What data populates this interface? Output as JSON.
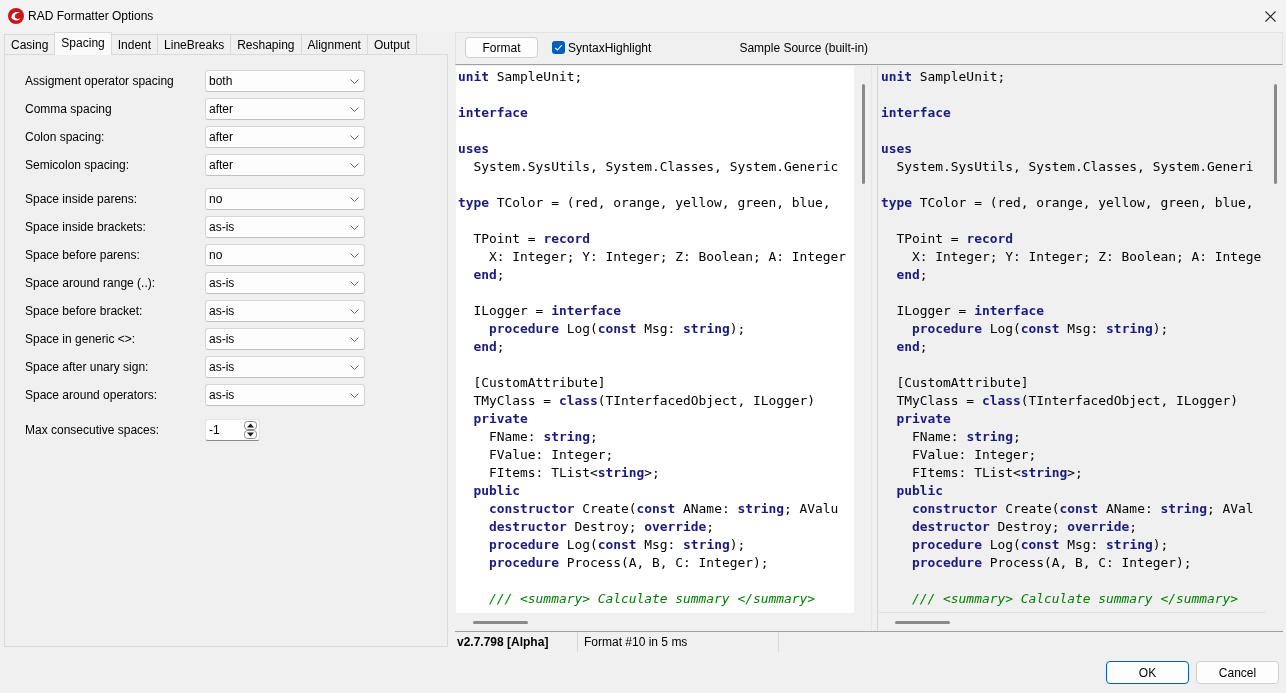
{
  "window": {
    "title": "RAD Formatter Options"
  },
  "tabs": [
    {
      "label": "Casing",
      "selected": false
    },
    {
      "label": "Spacing",
      "selected": true
    },
    {
      "label": "Indent",
      "selected": false
    },
    {
      "label": "LineBreaks",
      "selected": false
    },
    {
      "label": "Reshaping",
      "selected": false
    },
    {
      "label": "Alignment",
      "selected": false
    },
    {
      "label": "Output",
      "selected": false
    }
  ],
  "setting_groups": [
    {
      "settings": [
        {
          "kind": "dropdown",
          "label": "Assigment operator spacing",
          "value": "both"
        },
        {
          "kind": "dropdown",
          "label": "Comma spacing",
          "value": "after"
        },
        {
          "kind": "dropdown",
          "label": "Colon spacing:",
          "value": "after"
        },
        {
          "kind": "dropdown",
          "label": "Semicolon spacing:",
          "value": "after"
        }
      ]
    },
    {
      "settings": [
        {
          "kind": "dropdown",
          "label": "Space inside parens:",
          "value": "no"
        },
        {
          "kind": "dropdown",
          "label": "Space inside brackets:",
          "value": "as-is"
        },
        {
          "kind": "dropdown",
          "label": "Space before parens:",
          "value": "no"
        },
        {
          "kind": "dropdown",
          "label": "Space around range (..):",
          "value": "as-is"
        },
        {
          "kind": "dropdown",
          "label": "Space before bracket:",
          "value": "as-is"
        },
        {
          "kind": "dropdown",
          "label": "Space in generic <>:",
          "value": "as-is"
        },
        {
          "kind": "dropdown",
          "label": "Space after unary sign:",
          "value": "as-is"
        },
        {
          "kind": "dropdown",
          "label": "Space around operators:",
          "value": "as-is"
        }
      ]
    },
    {
      "settings": [
        {
          "kind": "spinner",
          "label": "Max consecutive spaces:",
          "value": "-1"
        }
      ]
    }
  ],
  "toolbar": {
    "format_button": "Format",
    "syntax_highlight": {
      "label": "SyntaxHighlight",
      "checked": true
    },
    "source_label": "Sample Source (built-in)"
  },
  "editors": [
    {
      "read_only": false,
      "blocks": [
        {
          "lines": [
            {
              "tokens": [
                {
                  "kind": "keyword",
                  "text": "unit"
                },
                {
                  "kind": "plain",
                  "text": " SampleUnit;"
                }
              ]
            }
          ]
        },
        {
          "lines": [
            {
              "tokens": [
                {
                  "kind": "keyword",
                  "text": "interface"
                }
              ]
            }
          ]
        },
        {
          "lines": [
            {
              "tokens": [
                {
                  "kind": "keyword",
                  "text": "uses"
                }
              ]
            },
            {
              "tokens": [
                {
                  "kind": "plain",
                  "text": "  System.SysUtils, System.Classes, System.Generic"
                }
              ]
            }
          ]
        },
        {
          "lines": [
            {
              "tokens": [
                {
                  "kind": "keyword",
                  "text": "type"
                },
                {
                  "kind": "plain",
                  "text": " TColor = (red, orange, yellow, green, blue,"
                }
              ]
            }
          ]
        },
        {
          "lines": [
            {
              "tokens": [
                {
                  "kind": "plain",
                  "text": "  TPoint = "
                },
                {
                  "kind": "keyword",
                  "text": "record"
                }
              ]
            },
            {
              "tokens": [
                {
                  "kind": "plain",
                  "text": "    X: Integer; Y: Integer; Z: Boolean; A: Integer"
                }
              ]
            },
            {
              "tokens": [
                {
                  "kind": "keyword",
                  "text": "  end"
                },
                {
                  "kind": "plain",
                  "text": ";"
                }
              ]
            }
          ]
        },
        {
          "lines": [
            {
              "tokens": [
                {
                  "kind": "plain",
                  "text": "  ILogger = "
                },
                {
                  "kind": "keyword",
                  "text": "interface"
                }
              ]
            },
            {
              "tokens": [
                {
                  "kind": "keyword",
                  "text": "    procedure"
                },
                {
                  "kind": "plain",
                  "text": " Log("
                },
                {
                  "kind": "keyword",
                  "text": "const"
                },
                {
                  "kind": "plain",
                  "text": " Msg: "
                },
                {
                  "kind": "keyword",
                  "text": "string"
                },
                {
                  "kind": "plain",
                  "text": ");"
                }
              ]
            },
            {
              "tokens": [
                {
                  "kind": "keyword",
                  "text": "  end"
                },
                {
                  "kind": "plain",
                  "text": ";"
                }
              ]
            }
          ]
        },
        {
          "lines": [
            {
              "tokens": [
                {
                  "kind": "plain",
                  "text": "  [CustomAttribute]"
                }
              ]
            },
            {
              "tokens": [
                {
                  "kind": "plain",
                  "text": "  TMyClass = "
                },
                {
                  "kind": "keyword",
                  "text": "class"
                },
                {
                  "kind": "plain",
                  "text": "(TInterfacedObject, ILogger)"
                }
              ]
            },
            {
              "tokens": [
                {
                  "kind": "keyword",
                  "text": "  private"
                }
              ]
            },
            {
              "tokens": [
                {
                  "kind": "plain",
                  "text": "    FName: "
                },
                {
                  "kind": "keyword",
                  "text": "string"
                },
                {
                  "kind": "plain",
                  "text": ";"
                }
              ]
            },
            {
              "tokens": [
                {
                  "kind": "plain",
                  "text": "    FValue: Integer;"
                }
              ]
            },
            {
              "tokens": [
                {
                  "kind": "plain",
                  "text": "    FItems: TList<"
                },
                {
                  "kind": "keyword",
                  "text": "string"
                },
                {
                  "kind": "plain",
                  "text": ">;"
                }
              ]
            },
            {
              "tokens": [
                {
                  "kind": "keyword",
                  "text": "  public"
                }
              ]
            },
            {
              "tokens": [
                {
                  "kind": "keyword",
                  "text": "    constructor"
                },
                {
                  "kind": "plain",
                  "text": " Create("
                },
                {
                  "kind": "keyword",
                  "text": "const"
                },
                {
                  "kind": "plain",
                  "text": " AName: "
                },
                {
                  "kind": "keyword",
                  "text": "string"
                },
                {
                  "kind": "plain",
                  "text": "; AValu"
                }
              ]
            },
            {
              "tokens": [
                {
                  "kind": "keyword",
                  "text": "    destructor"
                },
                {
                  "kind": "plain",
                  "text": " Destroy; "
                },
                {
                  "kind": "keyword",
                  "text": "override"
                },
                {
                  "kind": "plain",
                  "text": ";"
                }
              ]
            },
            {
              "tokens": [
                {
                  "kind": "keyword",
                  "text": "    procedure"
                },
                {
                  "kind": "plain",
                  "text": " Log("
                },
                {
                  "kind": "keyword",
                  "text": "const"
                },
                {
                  "kind": "plain",
                  "text": " Msg: "
                },
                {
                  "kind": "keyword",
                  "text": "string"
                },
                {
                  "kind": "plain",
                  "text": ");"
                }
              ]
            },
            {
              "tokens": [
                {
                  "kind": "keyword",
                  "text": "    procedure"
                },
                {
                  "kind": "plain",
                  "text": " Process(A, B, C: Integer);"
                }
              ]
            }
          ]
        },
        {
          "lines": [
            {
              "tokens": [
                {
                  "kind": "comment",
                  "text": "    /// <summary> Calculate summary </summary>"
                }
              ]
            }
          ]
        }
      ]
    },
    {
      "read_only": true,
      "blocks": [
        {
          "lines": [
            {
              "tokens": [
                {
                  "kind": "keyword",
                  "text": "unit"
                },
                {
                  "kind": "plain",
                  "text": " SampleUnit;"
                }
              ]
            }
          ]
        },
        {
          "lines": [
            {
              "tokens": [
                {
                  "kind": "keyword",
                  "text": "interface"
                }
              ]
            }
          ]
        },
        {
          "lines": [
            {
              "tokens": [
                {
                  "kind": "keyword",
                  "text": "uses"
                }
              ]
            },
            {
              "tokens": [
                {
                  "kind": "plain",
                  "text": "  System.SysUtils, System.Classes, System.Generi"
                }
              ]
            }
          ]
        },
        {
          "lines": [
            {
              "tokens": [
                {
                  "kind": "keyword",
                  "text": "type"
                },
                {
                  "kind": "plain",
                  "text": " TColor = (red, orange, yellow, green, blue,"
                }
              ]
            }
          ]
        },
        {
          "lines": [
            {
              "tokens": [
                {
                  "kind": "plain",
                  "text": "  TPoint = "
                },
                {
                  "kind": "keyword",
                  "text": "record"
                }
              ]
            },
            {
              "tokens": [
                {
                  "kind": "plain",
                  "text": "    X: Integer; Y: Integer; Z: Boolean; A: Intege"
                }
              ]
            },
            {
              "tokens": [
                {
                  "kind": "keyword",
                  "text": "  end"
                },
                {
                  "kind": "plain",
                  "text": ";"
                }
              ]
            }
          ]
        },
        {
          "lines": [
            {
              "tokens": [
                {
                  "kind": "plain",
                  "text": "  ILogger = "
                },
                {
                  "kind": "keyword",
                  "text": "interface"
                }
              ]
            },
            {
              "tokens": [
                {
                  "kind": "keyword",
                  "text": "    procedure"
                },
                {
                  "kind": "plain",
                  "text": " Log("
                },
                {
                  "kind": "keyword",
                  "text": "const"
                },
                {
                  "kind": "plain",
                  "text": " Msg: "
                },
                {
                  "kind": "keyword",
                  "text": "string"
                },
                {
                  "kind": "plain",
                  "text": ");"
                }
              ]
            },
            {
              "tokens": [
                {
                  "kind": "keyword",
                  "text": "  end"
                },
                {
                  "kind": "plain",
                  "text": ";"
                }
              ]
            }
          ]
        },
        {
          "lines": [
            {
              "tokens": [
                {
                  "kind": "plain",
                  "text": "  [CustomAttribute]"
                }
              ]
            },
            {
              "tokens": [
                {
                  "kind": "plain",
                  "text": "  TMyClass = "
                },
                {
                  "kind": "keyword",
                  "text": "class"
                },
                {
                  "kind": "plain",
                  "text": "(TInterfacedObject, ILogger)"
                }
              ]
            },
            {
              "tokens": [
                {
                  "kind": "keyword",
                  "text": "  private"
                }
              ]
            },
            {
              "tokens": [
                {
                  "kind": "plain",
                  "text": "    FName: "
                },
                {
                  "kind": "keyword",
                  "text": "string"
                },
                {
                  "kind": "plain",
                  "text": ";"
                }
              ]
            },
            {
              "tokens": [
                {
                  "kind": "plain",
                  "text": "    FValue: Integer;"
                }
              ]
            },
            {
              "tokens": [
                {
                  "kind": "plain",
                  "text": "    FItems: TList<"
                },
                {
                  "kind": "keyword",
                  "text": "string"
                },
                {
                  "kind": "plain",
                  "text": ">;"
                }
              ]
            },
            {
              "tokens": [
                {
                  "kind": "keyword",
                  "text": "  public"
                }
              ]
            },
            {
              "tokens": [
                {
                  "kind": "keyword",
                  "text": "    constructor"
                },
                {
                  "kind": "plain",
                  "text": " Create("
                },
                {
                  "kind": "keyword",
                  "text": "const"
                },
                {
                  "kind": "plain",
                  "text": " AName: "
                },
                {
                  "kind": "keyword",
                  "text": "string"
                },
                {
                  "kind": "plain",
                  "text": "; AVal"
                }
              ]
            },
            {
              "tokens": [
                {
                  "kind": "keyword",
                  "text": "    destructor"
                },
                {
                  "kind": "plain",
                  "text": " Destroy; "
                },
                {
                  "kind": "keyword",
                  "text": "override"
                },
                {
                  "kind": "plain",
                  "text": ";"
                }
              ]
            },
            {
              "tokens": [
                {
                  "kind": "keyword",
                  "text": "    procedure"
                },
                {
                  "kind": "plain",
                  "text": " Log("
                },
                {
                  "kind": "keyword",
                  "text": "const"
                },
                {
                  "kind": "plain",
                  "text": " Msg: "
                },
                {
                  "kind": "keyword",
                  "text": "string"
                },
                {
                  "kind": "plain",
                  "text": ");"
                }
              ]
            },
            {
              "tokens": [
                {
                  "kind": "keyword",
                  "text": "    procedure"
                },
                {
                  "kind": "plain",
                  "text": " Process(A, B, C: Integer);"
                }
              ]
            }
          ]
        },
        {
          "lines": [
            {
              "tokens": [
                {
                  "kind": "comment",
                  "text": "    /// <summary> Calculate summary </summary>"
                }
              ]
            }
          ]
        }
      ]
    }
  ],
  "status_bar": {
    "version": "v2.7.798 [Alpha]",
    "message": "Format #10 in 5 ms"
  },
  "buttons": [
    {
      "label": "OK",
      "default": true
    },
    {
      "label": "Cancel",
      "default": false
    }
  ]
}
